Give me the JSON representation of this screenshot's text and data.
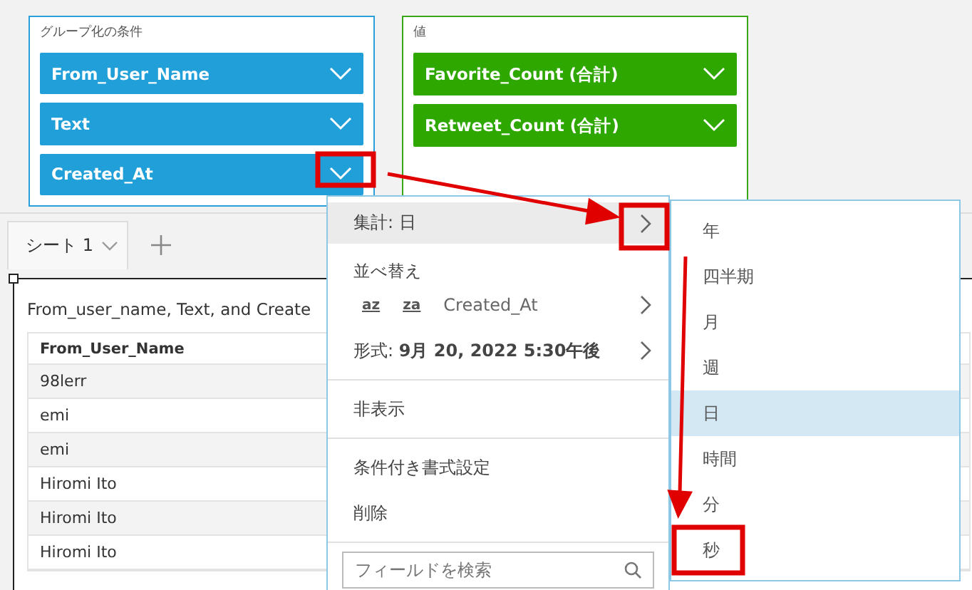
{
  "group_by": {
    "label": "グループ化の条件",
    "fields": [
      {
        "name": "From_User_Name"
      },
      {
        "name": "Text"
      },
      {
        "name": "Created_At"
      }
    ]
  },
  "values": {
    "label": "値",
    "fields": [
      {
        "name": "Favorite_Count (合計)"
      },
      {
        "name": "Retweet_Count (合計)"
      }
    ]
  },
  "sheet_tabs": [
    {
      "label": "シート 1",
      "selected": true
    }
  ],
  "visual": {
    "title": "From_user_name, Text, and Create",
    "table": {
      "columns": [
        "From_User_Name"
      ],
      "rows": [
        [
          "98lerr"
        ],
        [
          "emi"
        ],
        [
          "emi"
        ],
        [
          "Hiromi Ito"
        ],
        [
          "Hiromi Ito"
        ],
        [
          "Hiromi Ito"
        ]
      ]
    }
  },
  "context_menu": {
    "items": [
      {
        "kind": "submenu",
        "label": "集計: 日",
        "highlighted": true
      },
      {
        "kind": "heading",
        "label": "並べ替え",
        "highlighted": false
      },
      {
        "kind": "sort",
        "label": "Created_At",
        "sort_icons": [
          "az",
          "za"
        ],
        "highlighted": false
      },
      {
        "kind": "submenu",
        "label": "形式: **9月 20, 2022 5:30午後**",
        "highlighted": false
      },
      {
        "kind": "divider"
      },
      {
        "kind": "action",
        "label": "非表示",
        "highlighted": false
      },
      {
        "kind": "divider"
      },
      {
        "kind": "action",
        "label": "条件付き書式設定",
        "highlighted": false
      },
      {
        "kind": "action",
        "label": "削除",
        "highlighted": false
      },
      {
        "kind": "divider"
      }
    ],
    "search": {
      "placeholder": "フィールドを検索"
    }
  },
  "aggregation_submenu": {
    "items": [
      {
        "label": "年",
        "selected": false
      },
      {
        "label": "四半期",
        "selected": false
      },
      {
        "label": "月",
        "selected": false
      },
      {
        "label": "週",
        "selected": false
      },
      {
        "label": "日",
        "selected": true
      },
      {
        "label": "時間",
        "selected": false
      },
      {
        "label": "分",
        "selected": false
      },
      {
        "label": "秒",
        "selected": false
      }
    ]
  }
}
